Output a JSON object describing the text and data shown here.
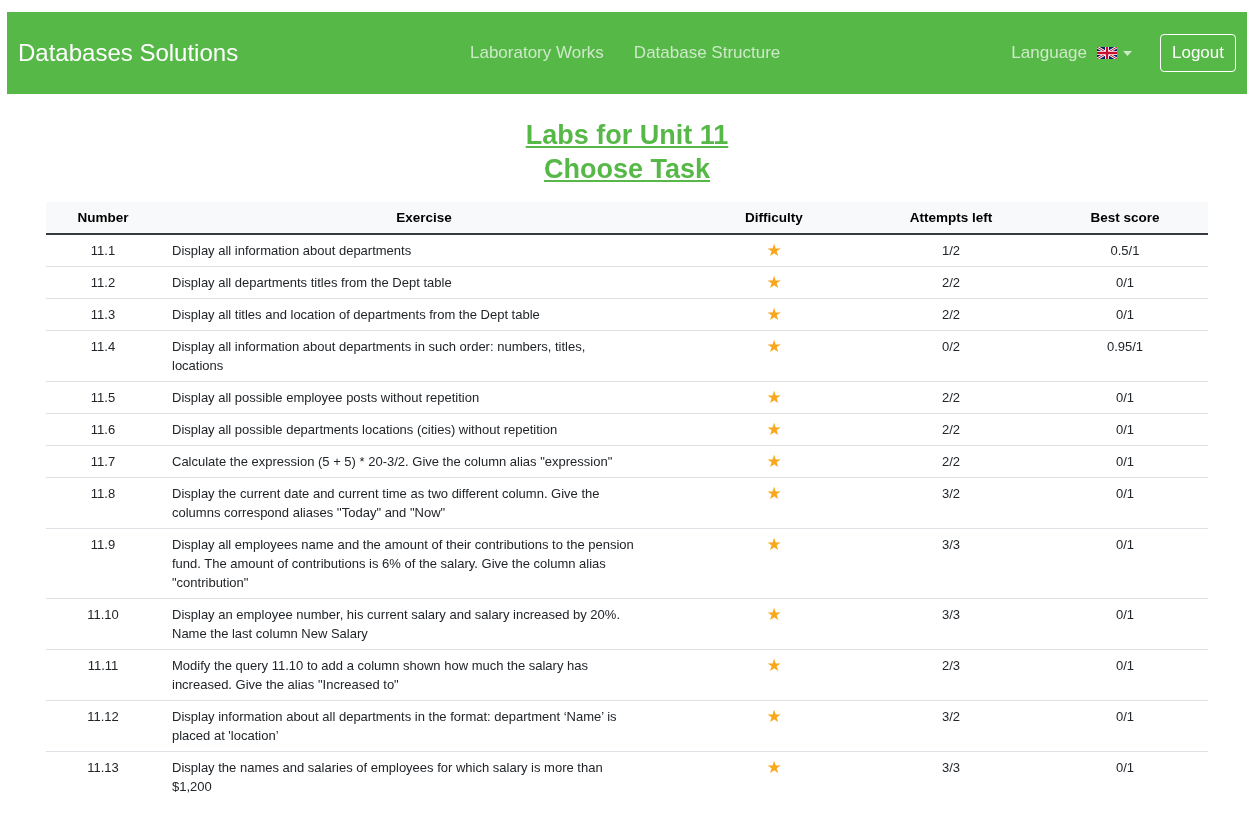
{
  "navbar": {
    "brand": "Databases Solutions",
    "links": [
      {
        "label": "Laboratory Works"
      },
      {
        "label": "Database Structure"
      }
    ],
    "language": "Language",
    "logout": "Logout"
  },
  "heading": {
    "line_1": "Labs for Unit 11",
    "line_2": "Choose Task"
  },
  "table": {
    "columns": [
      "Number",
      "Exercise",
      "Difficulty",
      "Attempts left",
      "Best score"
    ],
    "rows": [
      {
        "number": "11.1",
        "exercise": "Display all information about departments",
        "difficulty": "★",
        "attempts_left": "1/2",
        "best_score": "0.5/1"
      },
      {
        "number": "11.2",
        "exercise": "Display all departments titles from the Dept table",
        "difficulty": "★",
        "attempts_left": "2/2",
        "best_score": "0/1"
      },
      {
        "number": "11.3",
        "exercise": "Display all titles and location of departments from the Dept table",
        "difficulty": "★",
        "attempts_left": "2/2",
        "best_score": "0/1"
      },
      {
        "number": "11.4",
        "exercise": "Display all information about departments in such order: numbers, titles, locations",
        "difficulty": "★",
        "attempts_left": "0/2",
        "best_score": "0.95/1"
      },
      {
        "number": "11.5",
        "exercise": "Display all possible employee posts without repetition",
        "difficulty": "★",
        "attempts_left": "2/2",
        "best_score": "0/1"
      },
      {
        "number": "11.6",
        "exercise": "Display all possible departments locations (cities) without repetition",
        "difficulty": "★",
        "attempts_left": "2/2",
        "best_score": "0/1"
      },
      {
        "number": "11.7",
        "exercise": "Calculate the expression (5 + 5) * 20-3/2. Give the column alias \"expression\"",
        "difficulty": "★",
        "attempts_left": "2/2",
        "best_score": "0/1"
      },
      {
        "number": "11.8",
        "exercise": "Display the current date and current time as two different column. Give the columns correspond aliases ''Today\" and \"Now\"",
        "difficulty": "★",
        "attempts_left": "3/2",
        "best_score": "0/1"
      },
      {
        "number": "11.9",
        "exercise": "Display all employees name and the amount of their contributions to the pension fund. The amount of contributions is 6% of the salary. Give the column alias \"contribution\"",
        "difficulty": "★",
        "attempts_left": "3/3",
        "best_score": "0/1"
      },
      {
        "number": "11.10",
        "exercise": "Display an employee number, his current salary and salary increased by 20%. Name the last column New Salary",
        "difficulty": "★",
        "attempts_left": "3/3",
        "best_score": "0/1"
      },
      {
        "number": "11.11",
        "exercise": "Modify the query 11.10 to add a column shown how much the salary has increased. Give the alias \"Increased to\"",
        "difficulty": "★",
        "attempts_left": "2/3",
        "best_score": "0/1"
      },
      {
        "number": "11.12",
        "exercise": "Display information about all departments in the format: department ‘Name’ is placed at 'location’",
        "difficulty": "★",
        "attempts_left": "3/2",
        "best_score": "0/1"
      },
      {
        "number": "11.13",
        "exercise": "Display the names and salaries of employees for which salary is more than $1,200",
        "difficulty": "★",
        "attempts_left": "3/3",
        "best_score": "0/1"
      }
    ]
  }
}
